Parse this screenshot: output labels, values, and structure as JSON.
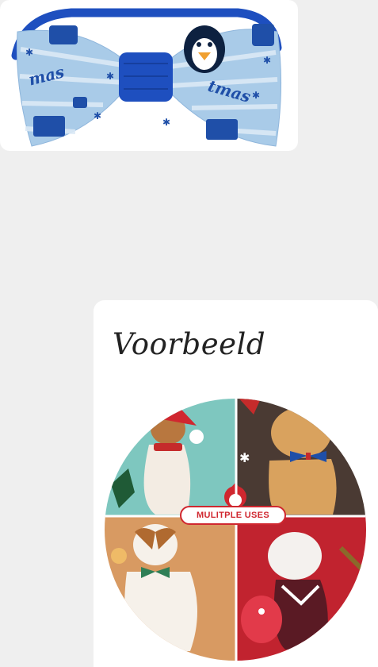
{
  "product": {
    "ribbon_text": "Christmas"
  },
  "example": {
    "heading": "Voorbeeld",
    "banner": "MULITPLE USES"
  },
  "colors": {
    "background": "#efefef",
    "bow_light_blue": "#a9cbe8",
    "bow_dark_blue": "#1f4fa8",
    "strap_blue": "#1e4fbf",
    "banner_red": "#d0272f"
  }
}
